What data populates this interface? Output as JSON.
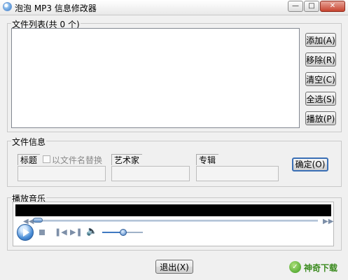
{
  "window": {
    "title": "泡泡 MP3 信息修改器",
    "minimize_glyph": "—",
    "maximize_glyph": "□",
    "close_glyph": "✕"
  },
  "file_list": {
    "group_label": "文件列表(共 0 个)",
    "items": [],
    "buttons": {
      "add": "添加(A)",
      "remove": "移除(R)",
      "clear": "清空(C)",
      "select_all": "全选(S)",
      "play": "播放(P)"
    }
  },
  "file_info": {
    "group_label": "文件信息",
    "title_label": "标题",
    "use_filename_label": "以文件名替换",
    "use_filename_checked": false,
    "artist_label": "艺术家",
    "album_label": "专辑",
    "title_value": "",
    "artist_value": "",
    "album_value": "",
    "confirm_button": "确定(O)"
  },
  "player": {
    "group_label": "播放音乐",
    "seek_fraction": 0.0,
    "volume_fraction": 0.5,
    "icons": [
      "play-icon",
      "stop-icon",
      "previous-icon",
      "next-icon",
      "volume-icon"
    ]
  },
  "footer": {
    "exit_button": "退出(X)",
    "watermark_text": "神奇下载"
  },
  "colors": {
    "background": "#f0f0f0",
    "accent": "#3f79c1",
    "video_black": "#000000",
    "close_red": "#c7432f"
  }
}
